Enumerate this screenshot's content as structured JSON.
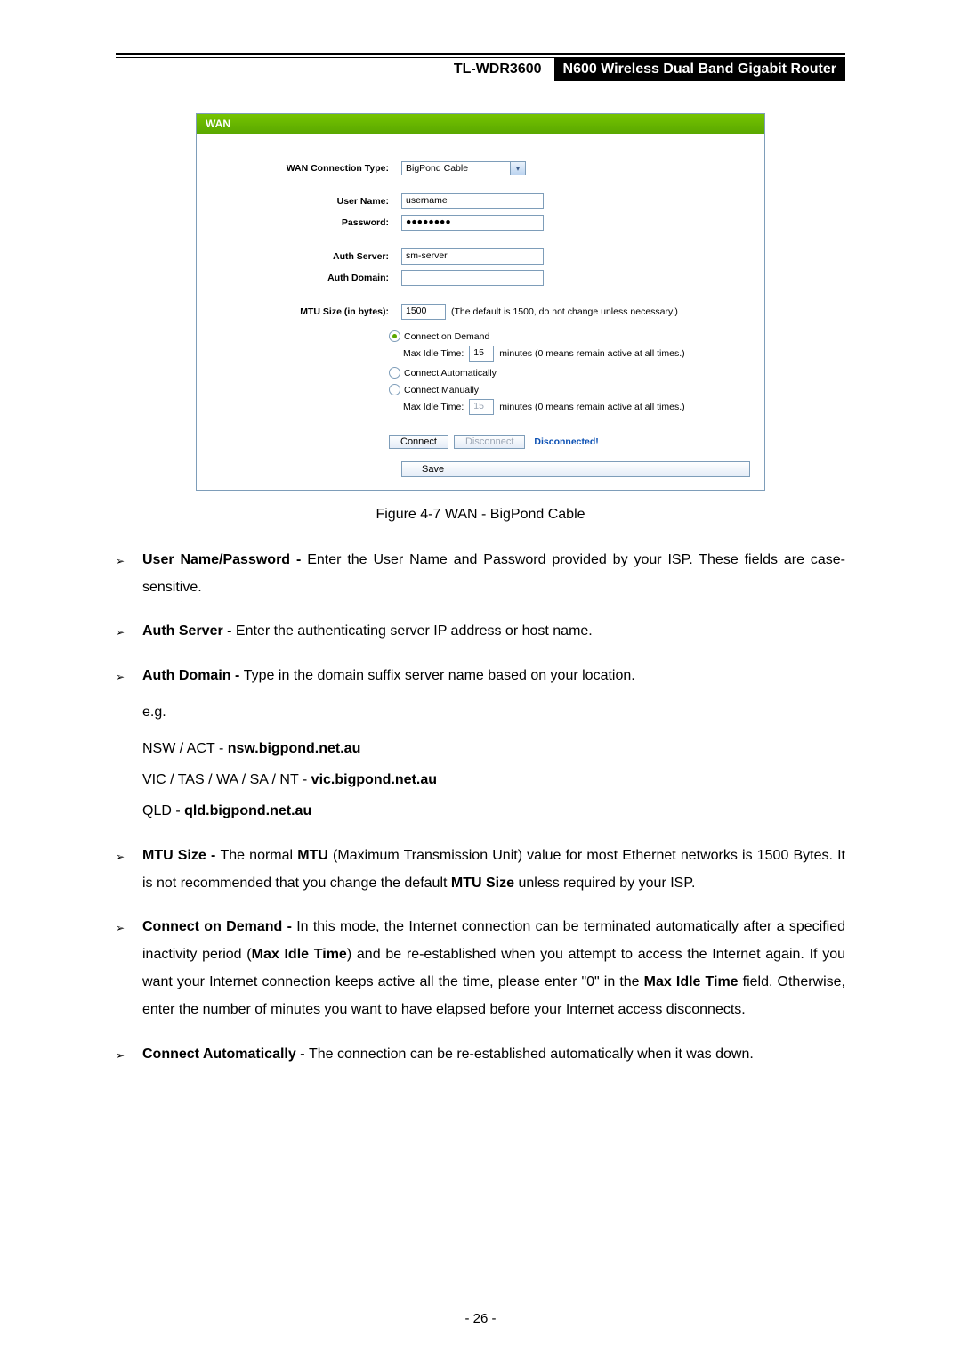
{
  "header": {
    "model": "TL-WDR3600",
    "title": "N600 Wireless Dual Band Gigabit Router"
  },
  "shot": {
    "panel_title": "WAN",
    "rows": {
      "conn_type_label": "WAN Connection Type:",
      "conn_type_value": "BigPond Cable",
      "user_label": "User Name:",
      "user_value": "username",
      "pass_label": "Password:",
      "pass_value": "●●●●●●●●",
      "auth_server_label": "Auth Server:",
      "auth_server_value": "sm-server",
      "auth_domain_label": "Auth Domain:",
      "auth_domain_value": "",
      "mtu_label": "MTU Size (in bytes):",
      "mtu_value": "1500",
      "mtu_hint": "(The default is 1500, do not change unless necessary.)",
      "opt_demand": "Connect on Demand",
      "opt_auto": "Connect Automatically",
      "opt_manual": "Connect Manually",
      "max_idle_label": "Max Idle Time:",
      "max_idle_value1": "15",
      "max_idle_value2": "15",
      "idle_hint": "minutes (0 means remain active at all times.)",
      "btn_connect": "Connect",
      "btn_disconnect": "Disconnect",
      "status": "Disconnected!",
      "btn_save": "Save"
    }
  },
  "caption": "Figure 4-7 WAN - BigPond Cable",
  "defs": {
    "d1a": "User Name/Password - ",
    "d1b": "Enter the User Name and Password provided by your ISP. These fields are case-sensitive.",
    "d2a": "Auth Server - ",
    "d2b": "Enter the authenticating server IP address or host name.",
    "d3a": "Auth Domain - ",
    "d3b": "Type in the domain suffix server name based on your location.",
    "eg": "e.g.",
    "l1a": "NSW / ACT - ",
    "l1b": "nsw.bigpond.net.au",
    "l2a": "VIC / TAS / WA / SA / NT - ",
    "l2b": "vic.bigpond.net.au",
    "l3a": "QLD - ",
    "l3b": "qld.bigpond.net.au",
    "d4a": "MTU Size - ",
    "d4b1": "The normal ",
    "d4b2": "MTU",
    "d4b3": " (Maximum Transmission Unit) value for most Ethernet networks is 1500 Bytes. It is not recommended that you change the default ",
    "d4b4": "MTU Size",
    "d4b5": " unless required by your ISP.",
    "d5a": "Connect on Demand - ",
    "d5b1": "In this mode, the Internet connection can be terminated automatically after a specified inactivity period (",
    "d5b2": "Max Idle Time",
    "d5b3": ") and be re-established when you attempt to access the Internet again. If you want your Internet connection keeps active all the time, please enter \"0\" in the ",
    "d5b4": "Max Idle Time",
    "d5b5": " field. Otherwise, enter the number of minutes you want to have elapsed before your Internet access disconnects.",
    "d6a": "Connect Automatically - ",
    "d6b": "The connection can be re-established automatically when it was down."
  },
  "page_number": "- 26 -"
}
